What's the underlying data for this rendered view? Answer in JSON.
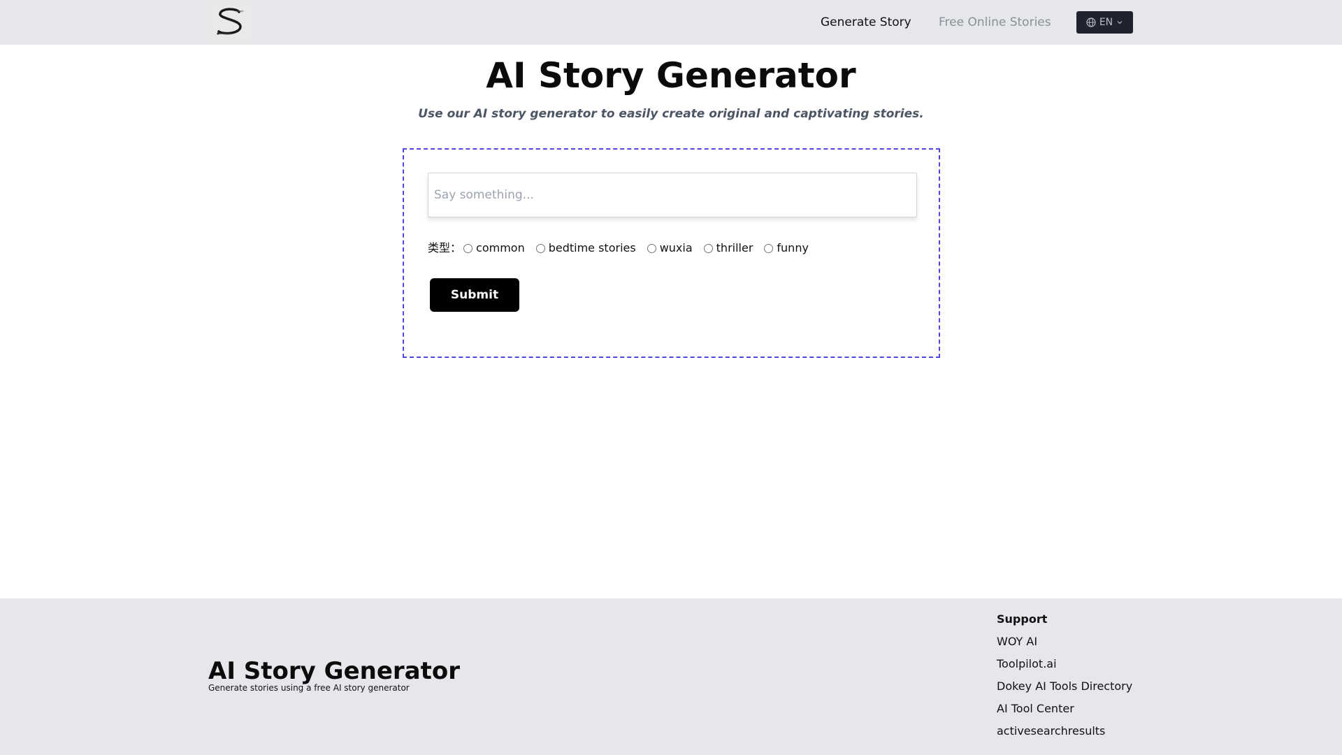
{
  "header": {
    "logo_icon": "s-logo-icon",
    "nav": {
      "generate_story": "Generate Story",
      "free_online_stories": "Free Online Stories"
    },
    "language": {
      "label": "EN",
      "icon": "globe-icon",
      "chevron": "chevron-down-icon"
    }
  },
  "main": {
    "title": "AI Story Generator",
    "subtitle": "Use our AI story generator to easily create original and captivating stories.",
    "form": {
      "prompt_placeholder": "Say something...",
      "prompt_value": "",
      "type_label": "类型：",
      "types": [
        "common",
        "bedtime stories",
        "wuxia",
        "thriller",
        "funny"
      ],
      "selected_type": null,
      "submit_label": "Submit",
      "border_color": "#4f46e5"
    }
  },
  "footer": {
    "title": "AI Story Generator",
    "tagline": "Generate stories using a free AI story generator",
    "support": {
      "heading": "Support",
      "links": [
        "WOY AI",
        "Toolpilot.ai",
        "Dokey AI Tools Directory",
        "AI Tool Center",
        "activesearchresults"
      ]
    }
  },
  "colors": {
    "header_bg": "#e5e7eb",
    "footer_bg": "#e5e7eb",
    "lang_button_bg": "#1f2330",
    "submit_bg": "#000000",
    "subtitle": "#4b5563",
    "nav_muted": "#8a8f98"
  }
}
